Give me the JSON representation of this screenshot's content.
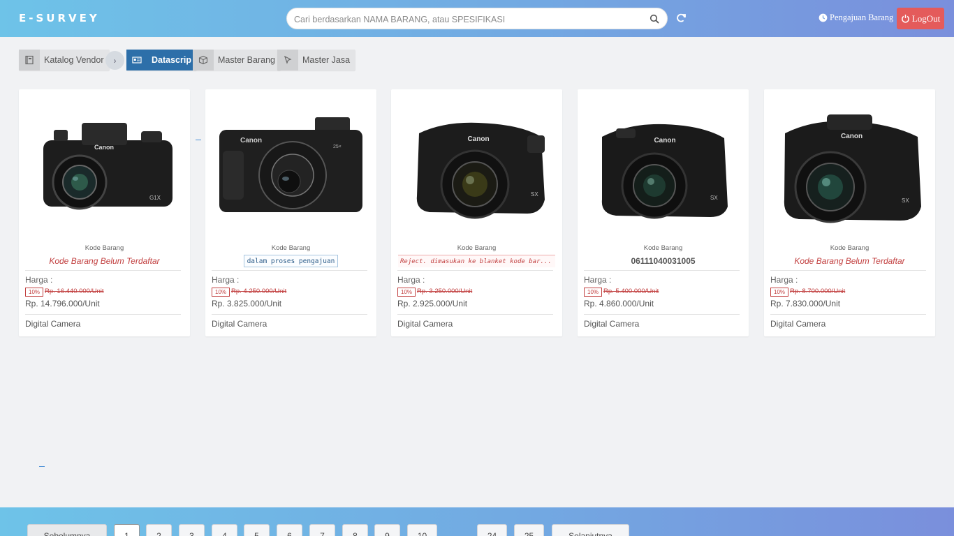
{
  "header": {
    "brand": "E-SURVEY",
    "search_placeholder": "Cari berdasarkan NAMA BARANG, atau SPESIFIKASI",
    "pengajuan_label": "Pengajuan Barang",
    "logout_label": "LogOut"
  },
  "breadcrumb": {
    "items": [
      {
        "label": "Katalog Vendor",
        "icon": "book-icon"
      },
      {
        "label": "Datascrip",
        "icon": "id-card-icon",
        "active": true
      },
      {
        "label": "Master Barang",
        "icon": "box-icon"
      },
      {
        "label": "Master Jasa",
        "icon": "cursor-icon"
      }
    ]
  },
  "cards": [
    {
      "kode_label": "Kode Barang",
      "kode": "Kode Barang Belum Terdaftar",
      "harga_label": "Harga :",
      "discount": "10%",
      "old_price": "Rp. 16.440.000/Unit",
      "price": "Rp. 14.796.000/Unit",
      "category": "Digital Camera"
    },
    {
      "kode_label": "Kode Barang",
      "kode": "dalam proses pengajuan",
      "harga_label": "Harga :",
      "discount": "10%",
      "old_price": "Rp. 4.250.000/Unit",
      "price": "Rp. 3.825.000/Unit",
      "category": "Digital Camera"
    },
    {
      "kode_label": "Kode Barang",
      "kode": "Reject. dimasukan ke blanket kode bar...",
      "harga_label": "Harga :",
      "discount": "10%",
      "old_price": "Rp. 3.250.000/Unit",
      "price": "Rp. 2.925.000/Unit",
      "category": "Digital Camera"
    },
    {
      "kode_label": "Kode Barang",
      "kode": "06111040031005",
      "harga_label": "Harga :",
      "discount": "10%",
      "old_price": "Rp. 5.400.000/Unit",
      "price": "Rp. 4.860.000/Unit",
      "category": "Digital Camera"
    },
    {
      "kode_label": "Kode Barang",
      "kode": "Kode Barang Belum Terdaftar",
      "harga_label": "Harga :",
      "discount": "10%",
      "old_price": "Rp. 8.700.000/Unit",
      "price": "Rp. 7.830.000/Unit",
      "category": "Digital Camera"
    }
  ],
  "pagination": {
    "prev": "Sebelumnya",
    "pages": [
      "1",
      "2",
      "3",
      "4",
      "5",
      "6",
      "7",
      "8",
      "9",
      "10"
    ],
    "tail_pages": [
      "24",
      "25"
    ],
    "next": "Selanjutnya",
    "current": "1"
  },
  "colors": {
    "accent": "#2d6fa9",
    "logout": "#e45b5b",
    "warning_text": "#c24040"
  }
}
